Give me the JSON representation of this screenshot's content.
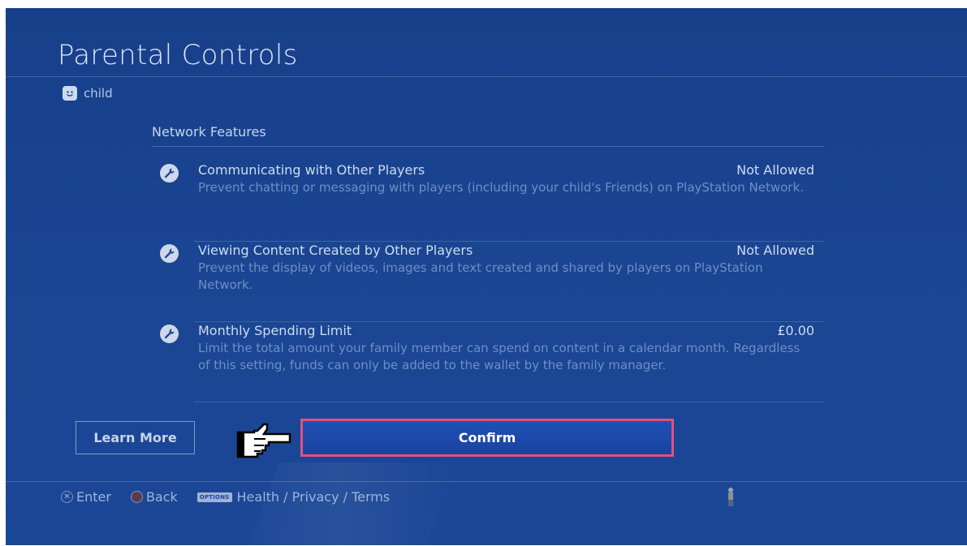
{
  "page": {
    "title": "Parental Controls"
  },
  "user": {
    "name": "child",
    "avatar_icon": "smiley-face-icon"
  },
  "section": {
    "header": "Network Features"
  },
  "settings": [
    {
      "icon": "wrench-icon",
      "name": "Communicating with Other Players",
      "value": "Not Allowed",
      "description": "Prevent chatting or messaging with players (including your child's Friends) on PlayStation Network."
    },
    {
      "icon": "wrench-icon",
      "name": "Viewing Content Created by Other Players",
      "value": "Not Allowed",
      "description": "Prevent the display of videos, images and text created and shared by players on PlayStation Network."
    },
    {
      "icon": "wrench-icon",
      "name": "Monthly Spending Limit",
      "value": "£0.00",
      "description": "Limit the total amount your family member can spend on content in a calendar month. Regardless of this setting, funds can only be added to the wallet by the family manager."
    }
  ],
  "buttons": {
    "learn_more": "Learn More",
    "confirm": "Confirm"
  },
  "footer": {
    "enter_label": "Enter",
    "back_label": "Back",
    "options_glyph": "OPTIONS",
    "options_label": "Health / Privacy / Terms"
  },
  "colors": {
    "background": "#1b4797",
    "confirm_button": "#1f50b4",
    "focus_border": "#e2507f",
    "description_text": "#6f8fc6"
  }
}
